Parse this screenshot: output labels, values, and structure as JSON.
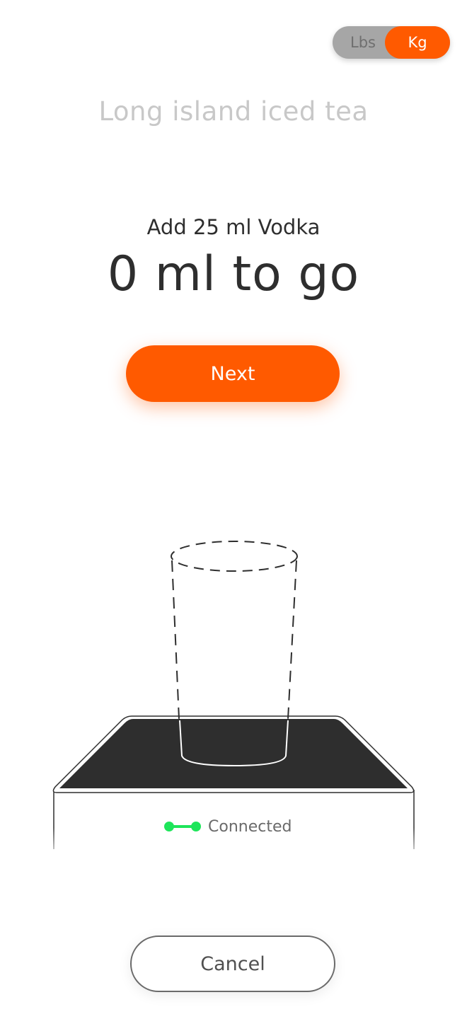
{
  "unit_toggle": {
    "options": [
      "Lbs",
      "Kg"
    ],
    "selected": "Kg"
  },
  "recipe": {
    "title": "Long island iced tea"
  },
  "step": {
    "instruction": "Add 25 ml Vodka",
    "remaining": "0 ml to go"
  },
  "actions": {
    "next_label": "Next",
    "cancel_label": "Cancel"
  },
  "device": {
    "status_label": "Connected",
    "status_icon": "connected-icon"
  },
  "colors": {
    "accent": "#ff5a00",
    "connected": "#1ee55a",
    "scale_top": "#2e2e2e"
  }
}
